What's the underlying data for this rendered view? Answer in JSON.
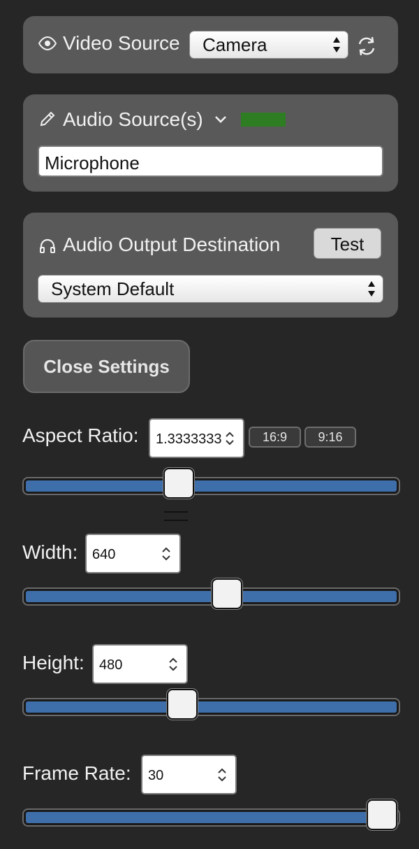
{
  "video_source": {
    "label": "Video Source",
    "selected": "Camera"
  },
  "audio_source": {
    "label": "Audio Source(s)",
    "value": "Microphone",
    "level_color": "#2e7d23"
  },
  "audio_output": {
    "label": "Audio Output Destination",
    "test_label": "Test",
    "selected": "System Default"
  },
  "close_settings_label": "Close Settings",
  "aspect_ratio": {
    "label": "Aspect Ratio:",
    "value": "1.3333333",
    "preset_1": "16:9",
    "preset_2": "9:16",
    "slider_fraction": 0.41
  },
  "width": {
    "label": "Width:",
    "value": "640",
    "slider_fraction": 0.55
  },
  "height": {
    "label": "Height:",
    "value": "480",
    "slider_fraction": 0.42
  },
  "frame_rate": {
    "label": "Frame Rate:",
    "value": "30",
    "slider_fraction": 1.0
  },
  "colors": {
    "background": "#262626",
    "panel": "#595959",
    "slider_fill": "#3f6faa"
  },
  "icons": {
    "video": "eye-icon",
    "refresh": "refresh-icon",
    "audio": "pen-icon",
    "chevron": "chevron-down-icon",
    "output": "headphones-icon"
  }
}
